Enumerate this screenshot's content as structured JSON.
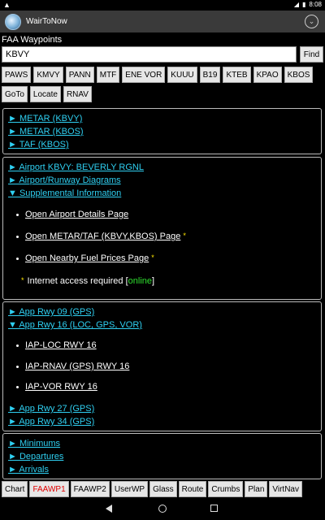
{
  "status": {
    "left_icon": "warning-triangle",
    "time": "8:08"
  },
  "app": {
    "title": "WairToNow",
    "icon": "globe-icon",
    "menu_icon": "chevron-down-circle"
  },
  "search": {
    "section_label": "FAA Waypoints",
    "value": "KBVY",
    "find_label": "Find"
  },
  "waypoint_buttons_row1": [
    "PAWS",
    "KMVY",
    "PANN",
    "MTF",
    "ENE VOR",
    "KUUU",
    "B19",
    "KTEB",
    "KPAO",
    "KBOS"
  ],
  "waypoint_buttons_row2": [
    "GoTo",
    "Locate",
    "RNAV"
  ],
  "panel_weather": {
    "links": [
      "► METAR (KBVY)",
      "► METAR (KBOS)",
      "► TAF (KBOS)"
    ]
  },
  "panel_airport": {
    "links": [
      "► Airport KBVY: BEVERLY RGNL",
      "► Airport/Runway Diagrams",
      "▼ Supplemental Information"
    ],
    "items": [
      {
        "text": "Open Airport Details Page",
        "star": ""
      },
      {
        "text": "Open METAR/TAF (KBVY,KBOS) Page",
        "star": "*"
      },
      {
        "text": "Open Nearby Fuel Prices Page",
        "star": "*"
      }
    ],
    "note_star": "*",
    "note_text": "Internet access required [",
    "note_status": "online",
    "note_close": "]"
  },
  "panel_approaches": {
    "links_top": [
      "► App Rwy 09 (GPS)",
      "▼ App Rwy 16 (LOC, GPS, VOR)"
    ],
    "items": [
      "IAP-LOC RWY 16",
      "IAP-RNAV (GPS) RWY 16",
      "IAP-VOR RWY 16"
    ],
    "links_bottom": [
      "► App Rwy 27 (GPS)",
      "► App Rwy 34 (GPS)"
    ]
  },
  "panel_procedures": {
    "links": [
      "► Minimums",
      "► Departures",
      "► Arrivals"
    ]
  },
  "bottom_tabs": [
    "Chart",
    "FAAWP1",
    "FAAWP2",
    "UserWP",
    "Glass",
    "Route",
    "Crumbs",
    "Plan",
    "VirtNav"
  ],
  "active_tab": "FAAWP1",
  "colors": {
    "link": "#2fd0f2",
    "star": "#ffe600",
    "online": "#2fe02f",
    "active_tab": "#e00000"
  }
}
